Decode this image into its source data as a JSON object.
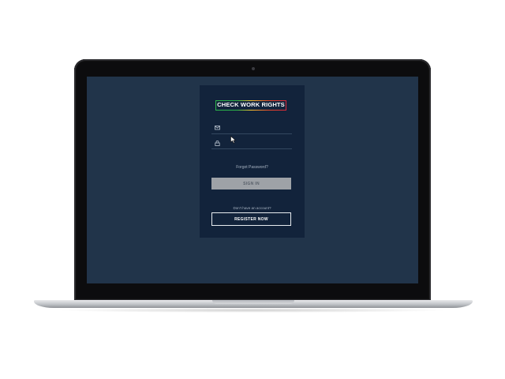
{
  "logo": {
    "text": "CHECK WORK RIGHTS"
  },
  "login": {
    "email_icon": "envelope-icon",
    "email_value": "",
    "password_icon": "lock-icon",
    "password_value": "",
    "forgot_password": "Forgot Password?",
    "sign_in_label": "SIGN IN",
    "no_account_text": "Don't have an account?",
    "register_label": "REGISTER NOW"
  },
  "colors": {
    "screen_bg": "#21344a",
    "card_bg": "#12233b",
    "sign_in_bg": "#9ea2a7",
    "logo_border": [
      "#2bb34a",
      "#f2c230",
      "#e44a2a",
      "#d5283a"
    ]
  }
}
